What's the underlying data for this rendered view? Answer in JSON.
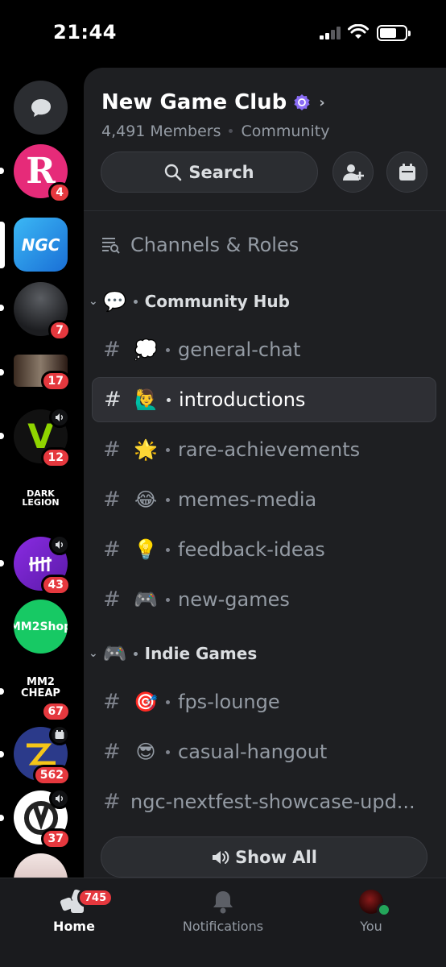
{
  "status_bar": {
    "time": "21:44"
  },
  "rail": {
    "servers": [
      {
        "name": "dm-button",
        "badge": ""
      },
      {
        "name": "server-r",
        "badge": "4",
        "logo_text": "R"
      },
      {
        "name": "server-ngc",
        "badge": "",
        "logo_text": "NGC"
      },
      {
        "name": "server-dark",
        "badge": "7"
      },
      {
        "name": "server-horror",
        "badge": "17"
      },
      {
        "name": "server-v",
        "badge": "12",
        "logo_text": "V"
      },
      {
        "name": "server-dark-legion",
        "badge": "",
        "logo_text": "DARK LEGION"
      },
      {
        "name": "server-dbd",
        "badge": "43"
      },
      {
        "name": "server-mm2shop",
        "badge": "",
        "logo_text": "MM2Shop"
      },
      {
        "name": "server-mm2cheap",
        "badge": "67",
        "logo_text": "MM2 CHEAP"
      },
      {
        "name": "server-zn",
        "badge": "562"
      },
      {
        "name": "server-overwatch",
        "badge": "37"
      }
    ]
  },
  "header": {
    "server_name": "New Game Club",
    "members": "4,491 Members",
    "type": "Community",
    "search_label": "Search"
  },
  "channels_roles_label": "Channels & Roles",
  "categories": [
    {
      "emoji": "💬",
      "name": "Community Hub"
    },
    {
      "emoji": "🎮",
      "name": "Indie Games"
    }
  ],
  "channels": [
    {
      "emoji": "💭",
      "name": "general-chat"
    },
    {
      "emoji": "🙋‍♂️",
      "name": "introductions",
      "active": true
    },
    {
      "emoji": "🌟",
      "name": "rare-achievements"
    },
    {
      "emoji": "😂",
      "name": "memes-media"
    },
    {
      "emoji": "💡",
      "name": "feedback-ideas"
    },
    {
      "emoji": "🎮",
      "name": "new-games"
    },
    {
      "emoji": "🎯",
      "name": "fps-lounge"
    },
    {
      "emoji": "😎",
      "name": "casual-hangout"
    },
    {
      "emoji": "",
      "name": "ngc-nextfest-showcase-upd..."
    }
  ],
  "show_all_label": "Show All",
  "tabbar": {
    "home_label": "Home",
    "home_badge": "745",
    "notifications_label": "Notifications",
    "you_label": "You"
  },
  "colors": {
    "accent_red": "#e5383e",
    "online_green": "#23a55a",
    "panel_bg": "#1e1f22"
  }
}
